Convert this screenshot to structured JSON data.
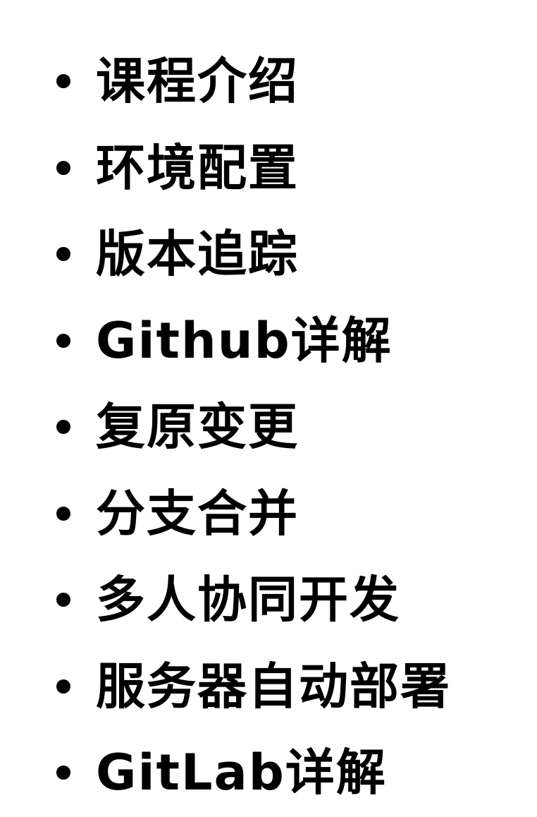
{
  "colors": {
    "background": "#ffffff",
    "text": "#000000"
  },
  "list": {
    "items": [
      "课程介绍",
      "环境配置",
      "版本追踪",
      "Github详解",
      "复原变更",
      "分支合并",
      "多人协同开发",
      "服务器自动部署",
      "GitLab详解"
    ]
  }
}
